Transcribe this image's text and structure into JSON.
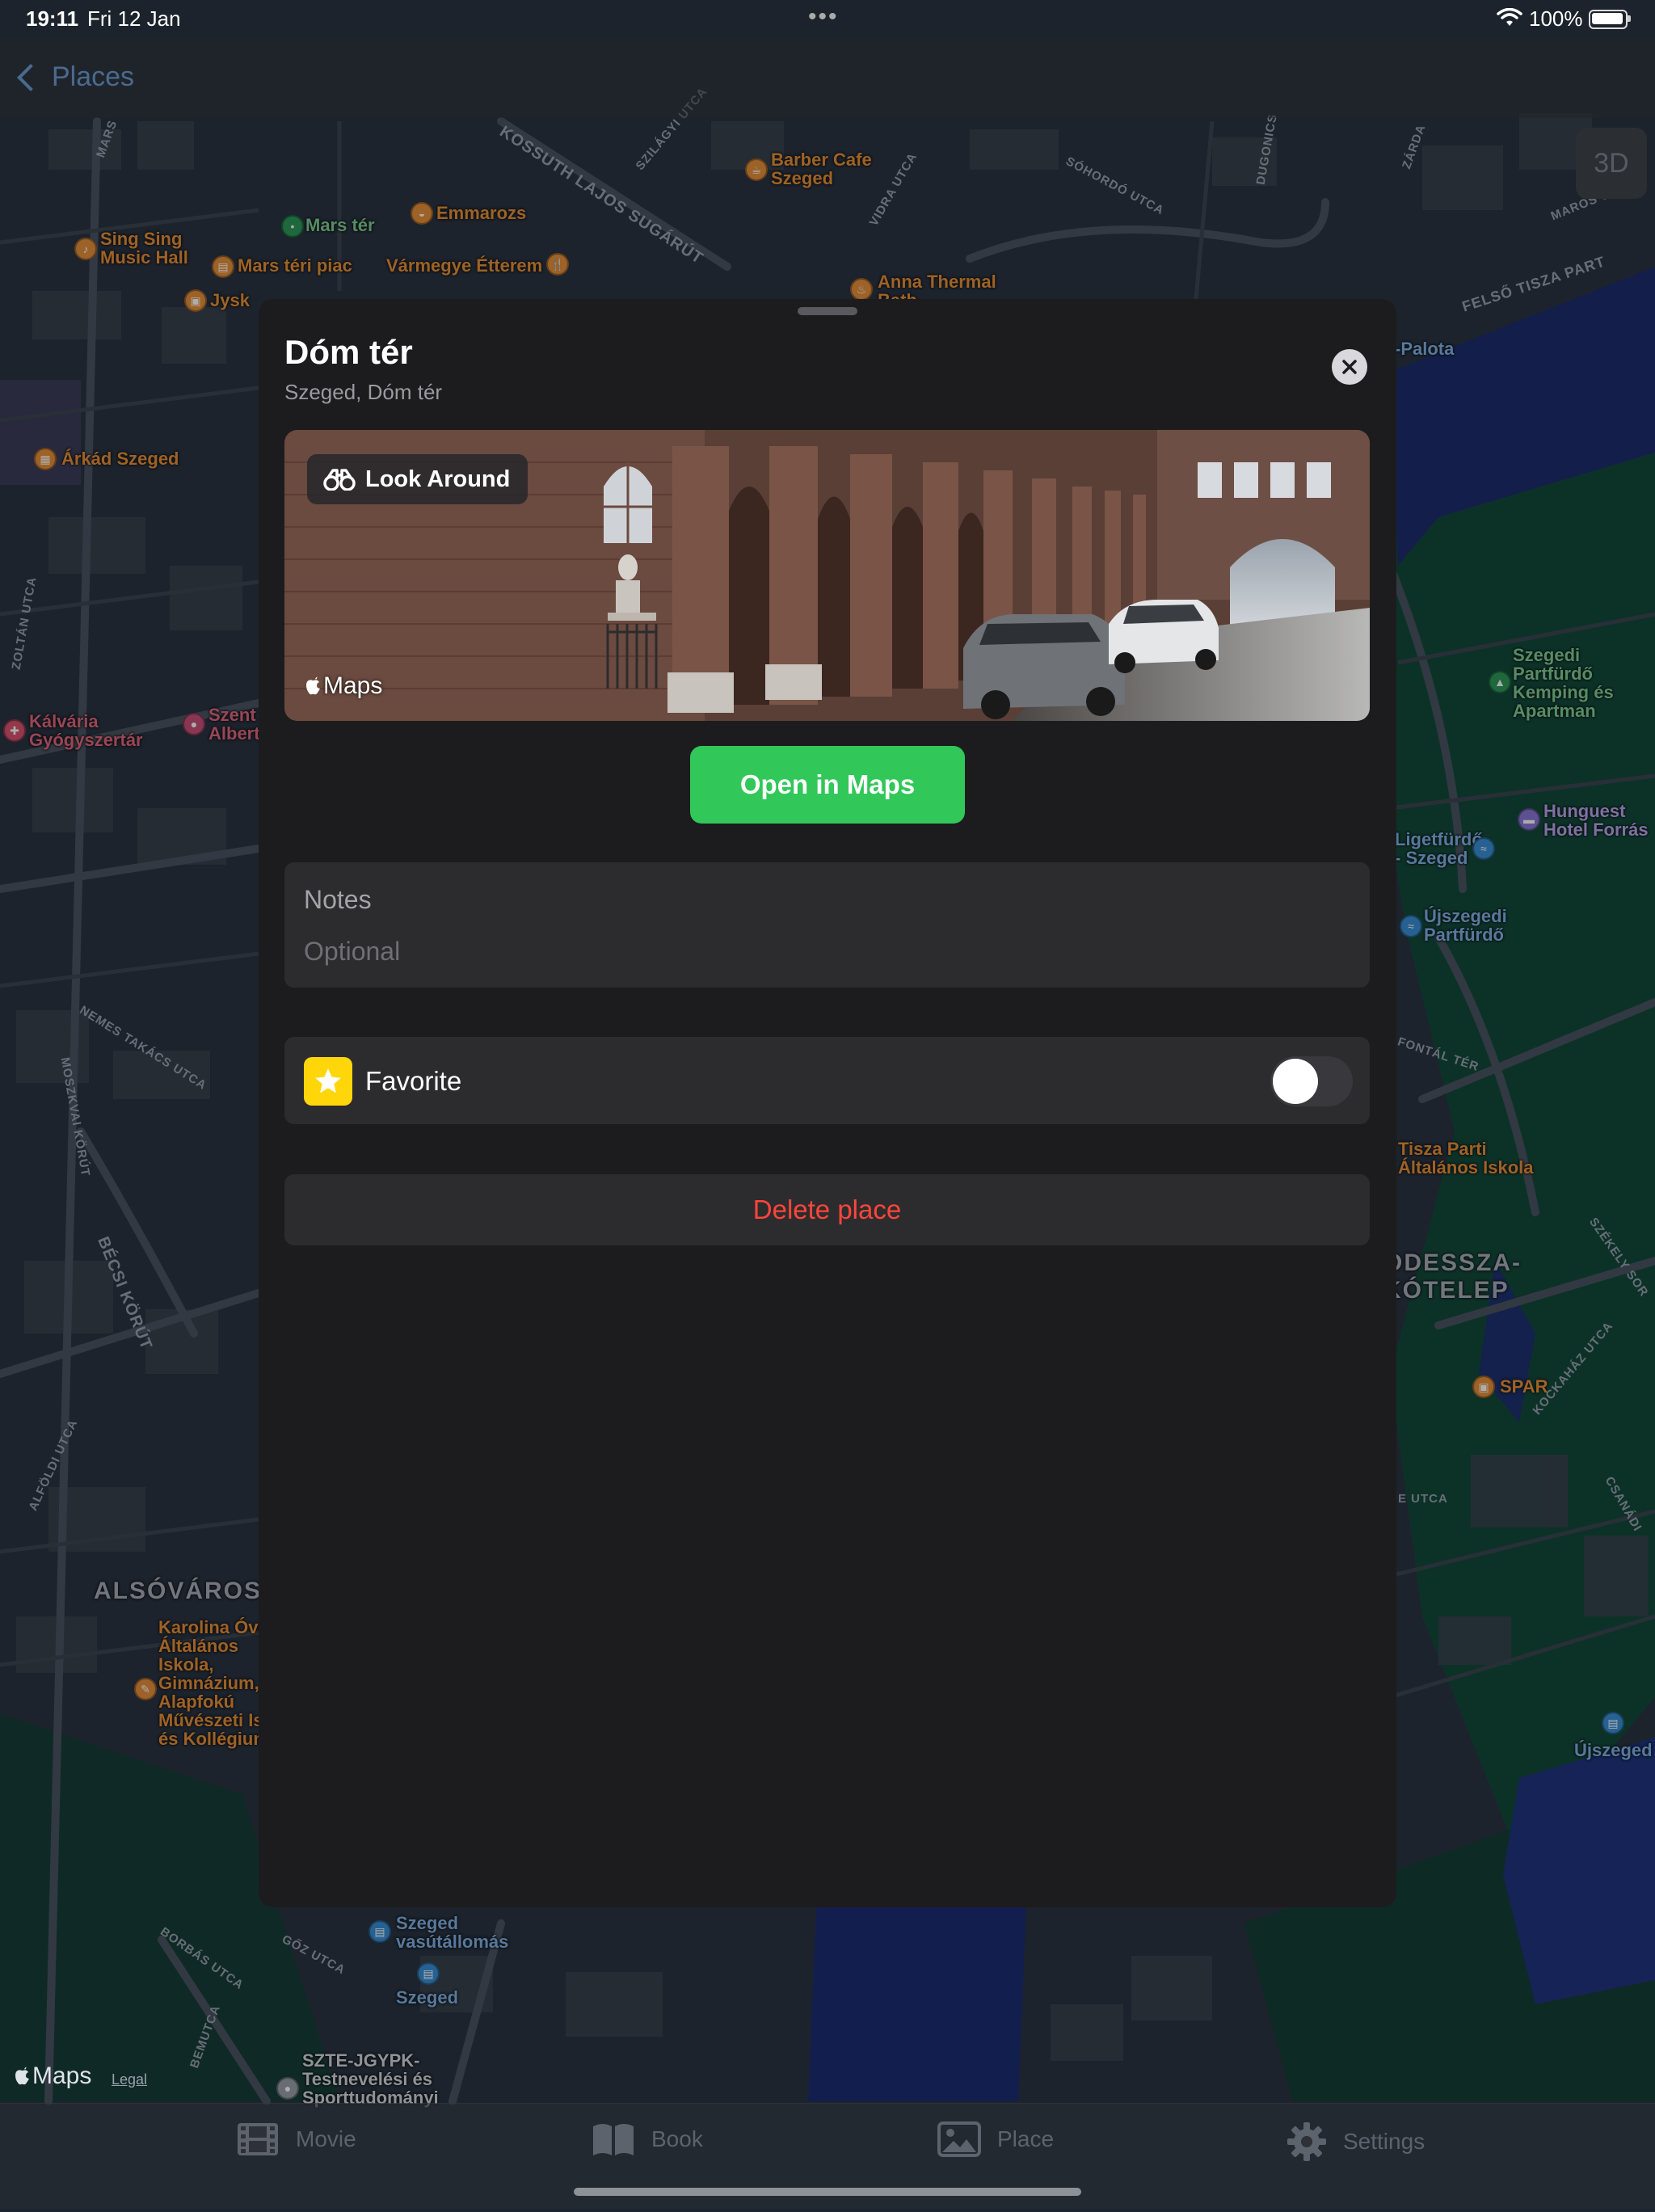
{
  "status_bar": {
    "time": "19:11",
    "date": "Fri 12 Jan",
    "dots": "•••",
    "battery": "100%"
  },
  "navbar": {
    "back_label": "Places",
    "view_3d": "3D"
  },
  "map": {
    "labels": [
      {
        "text": "Sing Sing\nMusic Hall",
        "color": "orange"
      },
      {
        "text": "Mars tér",
        "color": "green"
      },
      {
        "text": "Emmarozs",
        "color": "orange"
      },
      {
        "text": "Barber Cafe\nSzeged",
        "color": "orange"
      },
      {
        "text": "Mars téri piac",
        "color": "orange"
      },
      {
        "text": "Vármegye Étterem",
        "color": "orange"
      },
      {
        "text": "Jysk",
        "color": "orange"
      },
      {
        "text": "Anna Thermal\nBath",
        "color": "orange"
      },
      {
        "text": "Árkád Szeged",
        "color": "orange"
      },
      {
        "text": "Kálvária\nGyógyszertár",
        "color": "pink"
      },
      {
        "text": "Szent\nAlbert",
        "color": "pink"
      },
      {
        "text": "Szegedi\nPartfürdő\nKemping és\nApartman",
        "color": "green"
      },
      {
        "text": "Hunguest\nHotel Forrás",
        "color": "purple"
      },
      {
        "text": "Ligetfürdő\n- Szeged",
        "color": "blue"
      },
      {
        "text": "Újszegedi\nPartfürdő",
        "color": "blue"
      },
      {
        "text": "Tisza Parti\nÁltalános Iskola",
        "color": "orange"
      },
      {
        "text": "SPAR",
        "color": "orange"
      },
      {
        "text": "Karolina Óvoda,\nÁltalános\nIskola,\nGimnázium,\nAlapfokú\nMűvészeti Iskola\nés Kollégium",
        "color": "orange"
      },
      {
        "text": "Szeged\nvasútállomás",
        "color": "blue"
      },
      {
        "text": "Szeged",
        "color": "blue"
      },
      {
        "text": "Újszeged",
        "color": "blue"
      },
      {
        "text": "SZTE-JGYPK-\nTestnevelési és\nSporttudományi",
        "color": "white"
      },
      {
        "text": "-Palota",
        "color": "blue"
      }
    ],
    "districts": [
      "ALSÓVÁROS",
      "ODESSZA-\nKÓTELEP"
    ],
    "streets": [
      "KOSSUTH LAJOS SUGÁRÚT",
      "SZILÁGYI UTCA",
      "VIDRA UTCA",
      "SÓHORDÓ UTCA",
      "DUGONICS",
      "FELSŐ TISZA PART",
      "MAROS UTCA",
      "ZÁRDA",
      "ZOLTÁN UTCA",
      "NEMES TAKÁCS UTCA",
      "MOSZKVAI KÖRÚT",
      "BÉCSI KÖRÚT",
      "ALFÖLDI UTCA",
      "BORBÁS UTCA",
      "GŐZ UTCA",
      "BEMUTCA",
      "SZÉKELY SOR",
      "KOCKAHÁZ UTCA",
      "CSANÁDI",
      "FONTÁL TÉR",
      "E UTCA",
      "MARS"
    ],
    "maps_logo": "Maps",
    "legal": "Legal"
  },
  "sheet": {
    "title": "Dóm tér",
    "subtitle": "Szeged, Dóm tér",
    "look_around": "Look Around",
    "preview_logo": "Maps",
    "open_in_maps": "Open in Maps",
    "notes_label": "Notes",
    "notes_placeholder": "Optional",
    "favorite_label": "Favorite",
    "favorite_on": false,
    "delete_label": "Delete place"
  },
  "tabs": [
    {
      "label": "Movie",
      "icon": "film-icon"
    },
    {
      "label": "Book",
      "icon": "book-icon"
    },
    {
      "label": "Place",
      "icon": "photo-icon"
    },
    {
      "label": "Settings",
      "icon": "gear-icon"
    }
  ],
  "colors": {
    "accent_green": "#31c759",
    "destructive": "#ff453a",
    "favorite_yellow": "#ffd60a",
    "sheet_bg": "#1c1c1e",
    "card_bg": "#2c2c2e"
  }
}
